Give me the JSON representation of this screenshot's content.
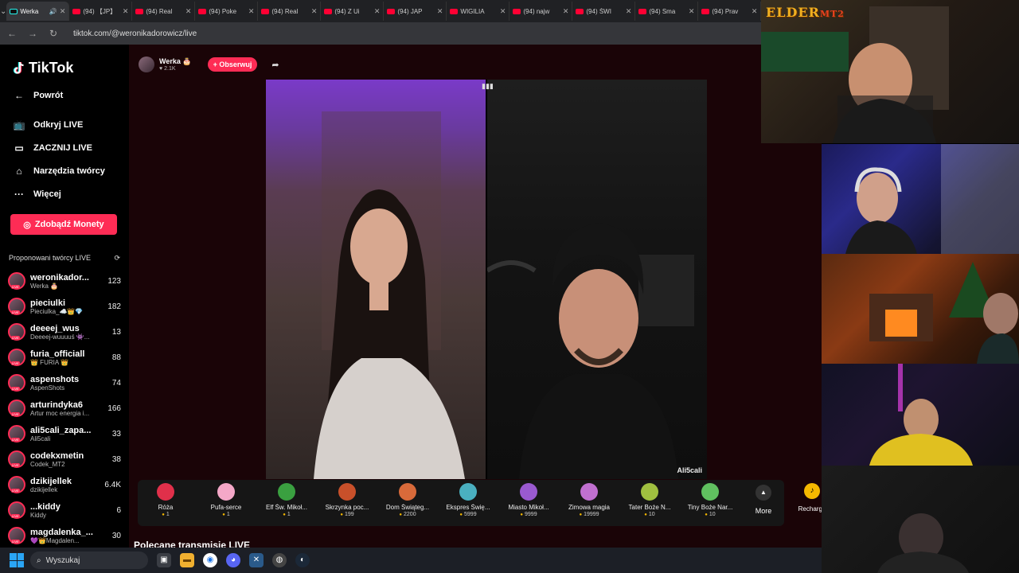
{
  "browser": {
    "tabs": [
      {
        "title": "Werka",
        "active": true,
        "icon": "tiktok"
      },
      {
        "title": "(94) 【JP】",
        "icon": "youtube"
      },
      {
        "title": "(94) Real",
        "icon": "youtube"
      },
      {
        "title": "(94) Poke",
        "icon": "youtube"
      },
      {
        "title": "(94) Real",
        "icon": "youtube"
      },
      {
        "title": "(94) Z Ui",
        "icon": "youtube"
      },
      {
        "title": "(94) JAP",
        "icon": "youtube"
      },
      {
        "title": "WIGILIA",
        "icon": "youtube"
      },
      {
        "title": "(94) najw",
        "icon": "youtube"
      },
      {
        "title": "(94) ŚWI",
        "icon": "youtube"
      },
      {
        "title": "(94) Sma",
        "icon": "youtube"
      },
      {
        "title": "(94) Prav",
        "icon": "youtube"
      }
    ],
    "url": "tiktok.com/@weronikadorowicz/live"
  },
  "sidebar": {
    "logo": "TikTok",
    "back": "Powrót",
    "nav": [
      {
        "label": "Odkryj LIVE",
        "icon": "tv-icon"
      },
      {
        "label": "ZACZNIJ LIVE",
        "icon": "video-camera-icon"
      },
      {
        "label": "Narzędzia twórcy",
        "icon": "home-icon"
      },
      {
        "label": "Więcej",
        "icon": "more-icon"
      }
    ],
    "coins_button": "Zdobądź Monety",
    "suggested_title": "Proponowani twórcy LIVE",
    "creators": [
      {
        "name": "weronikador...",
        "sub": "Werka 🎂",
        "count": "123"
      },
      {
        "name": "pieciulki",
        "sub": "Pieciulka_☁️👑💎",
        "count": "182"
      },
      {
        "name": "deeeej_wus",
        "sub": "Deeeej-wuuuuś 👾...",
        "count": "13"
      },
      {
        "name": "furia_officiall",
        "sub": "👑 FURIA 👑",
        "count": "88"
      },
      {
        "name": "aspenshots",
        "sub": "AspenShots",
        "count": "74"
      },
      {
        "name": "arturindyka6",
        "sub": "Artur moc energia i...",
        "count": "166"
      },
      {
        "name": "ali5cali_zapa...",
        "sub": "Ali5cali",
        "count": "33"
      },
      {
        "name": "codekxmetin",
        "sub": "Codek_MT2",
        "count": "38"
      },
      {
        "name": "dzikijellek",
        "sub": "dzikijellek",
        "count": "6.4K"
      },
      {
        "name": "...kiddy",
        "sub": "Kiddy",
        "count": "6"
      },
      {
        "name": "magdalenka_...",
        "sub": "💜👑Magdalen...",
        "count": "30"
      }
    ]
  },
  "host": {
    "name": "Werka 🎂",
    "likes": "♥ 2.1K",
    "follow": "+ Obserwuj"
  },
  "stream": {
    "guest_name": "Ali5cali"
  },
  "gifts": [
    {
      "name": "Róża",
      "price": "1",
      "color": "#e0304a"
    },
    {
      "name": "Pufa-serce",
      "price": "1",
      "color": "#f4a8c8"
    },
    {
      "name": "Elf Św. Mikoł...",
      "price": "1",
      "color": "#3aa040"
    },
    {
      "name": "Skrzynka poc...",
      "price": "199",
      "color": "#c8502a"
    },
    {
      "name": "Dom Świąteg...",
      "price": "2200",
      "color": "#d86a3a"
    },
    {
      "name": "Ekspres Świę...",
      "price": "5999",
      "color": "#4ab0c0"
    },
    {
      "name": "Miasto Mikoł...",
      "price": "9999",
      "color": "#9a5ad0"
    },
    {
      "name": "Zimowa magia",
      "price": "19999",
      "color": "#c070d0"
    },
    {
      "name": "Tater Boże N...",
      "price": "10",
      "color": "#a0c040"
    },
    {
      "name": "Tiny Boże Nar...",
      "price": "10",
      "color": "#60c060"
    }
  ],
  "more_label": "More",
  "recharge_label": "Recharge",
  "recommended_title": "Polecane transmisje LIVE",
  "webcam_overlay": {
    "logo_main": "ELDER",
    "logo_sub": "MT2"
  },
  "taskbar": {
    "search_placeholder": "Wyszukaj"
  }
}
